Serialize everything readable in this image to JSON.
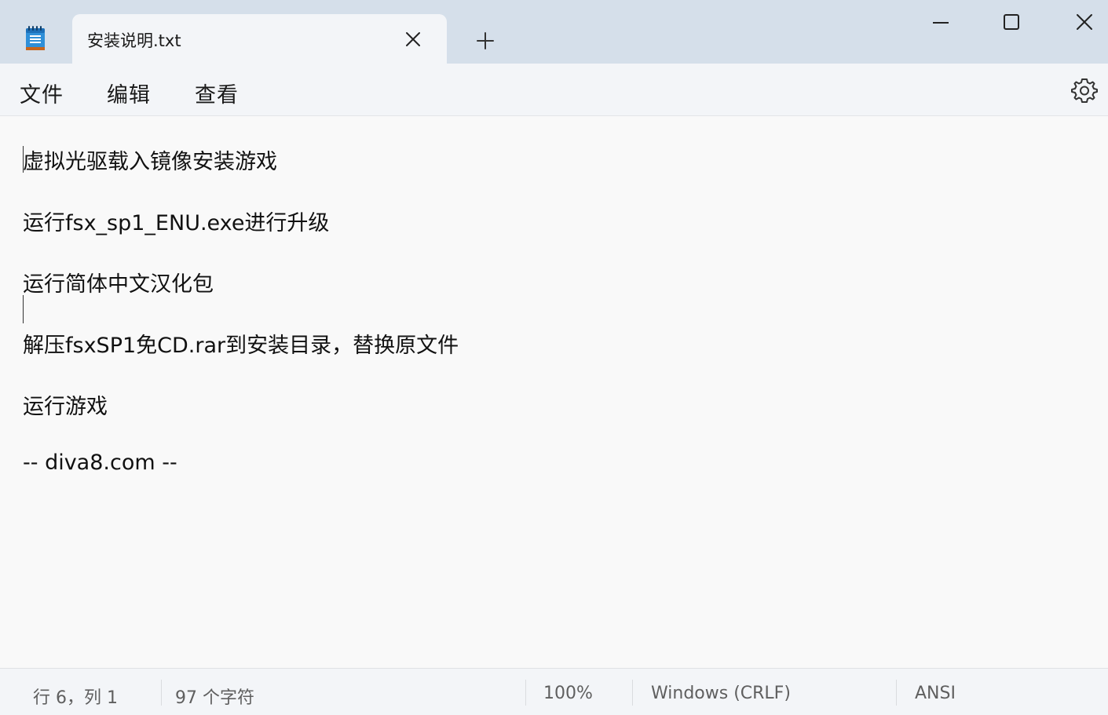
{
  "window": {
    "tab_title": "安装说明.txt"
  },
  "menu": {
    "file": "文件",
    "edit": "编辑",
    "view": "查看"
  },
  "editor": {
    "lines": [
      "虚拟光驱载入镜像安装游戏",
      "",
      "运行fsx_sp1_ENU.exe进行升级",
      "",
      "运行简体中文汉化包",
      "",
      "解压fsxSP1免CD.rar到安装目录，替换原文件",
      "",
      "运行游戏",
      "",
      "-- diva8.com --"
    ]
  },
  "status": {
    "position": "行 6，列 1",
    "char_count": "97 个字符",
    "zoom": "100%",
    "line_ending": "Windows (CRLF)",
    "encoding": "ANSI"
  },
  "icons": {
    "app": "notepad-icon",
    "tab_close": "close-icon",
    "new_tab": "plus-icon",
    "minimize": "minimize-icon",
    "maximize": "maximize-icon",
    "close": "close-icon",
    "settings": "gear-icon"
  },
  "colors": {
    "titlebar": "#d5dfea",
    "tab_active": "#f3f5f8",
    "editor_bg": "#f9f9f9"
  }
}
